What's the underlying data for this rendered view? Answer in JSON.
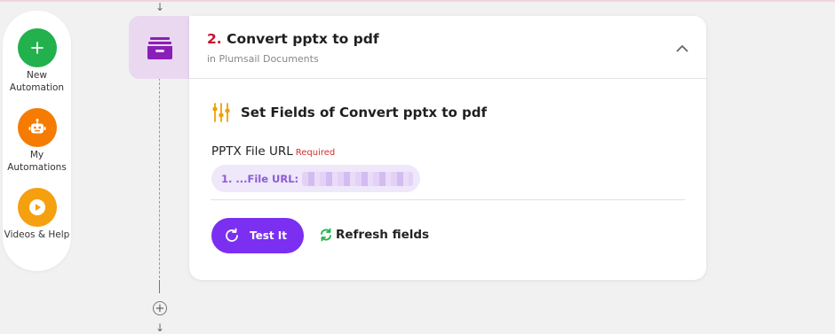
{
  "sidebar": {
    "items": [
      {
        "label": "New Automation",
        "icon": "plus-icon",
        "color": "#22b14c"
      },
      {
        "label": "My Automations",
        "icon": "robot-icon",
        "color": "#f57c00"
      },
      {
        "label": "Videos & Help",
        "icon": "play-icon",
        "color": "#f5a00f"
      }
    ]
  },
  "flow": {
    "arrow_glyph": "↓",
    "add_glyph": "+"
  },
  "step": {
    "number": "2.",
    "title": "Convert pptx to pdf",
    "subtitle": "in Plumsail Documents",
    "icon": "archive-tray-icon",
    "accent": "#8a1fb8"
  },
  "section": {
    "title": "Set Fields of Convert pptx to pdf",
    "icon": "sliders-icon",
    "icon_color": "#f0a000"
  },
  "field": {
    "label": "PPTX File URL",
    "required": "Required",
    "value": "1. ...File URL:"
  },
  "actions": {
    "test_label": "Test It",
    "refresh_label": "Refresh fields",
    "primary_color": "#7b2ff0",
    "refresh_color": "#22b14c"
  }
}
